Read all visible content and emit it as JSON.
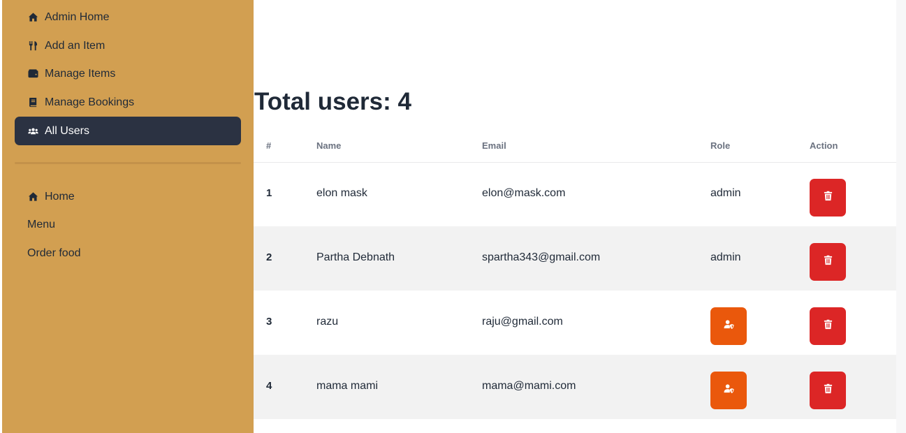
{
  "sidebar": {
    "admin_items": [
      {
        "label": "Admin Home",
        "icon": "home-icon"
      },
      {
        "label": "Add an Item",
        "icon": "utensils-icon"
      },
      {
        "label": "Manage Items",
        "icon": "wallet-icon"
      },
      {
        "label": "Manage Bookings",
        "icon": "book-icon"
      },
      {
        "label": "All Users",
        "icon": "users-icon",
        "active": true
      }
    ],
    "public_items": [
      {
        "label": "Home",
        "icon": "home-icon"
      },
      {
        "label": "Menu"
      },
      {
        "label": "Order food"
      }
    ]
  },
  "main": {
    "title": "Total users: 4",
    "table": {
      "headers": [
        "#",
        "Name",
        "Email",
        "Role",
        "Action"
      ],
      "rows": [
        {
          "num": "1",
          "name": "elon mask",
          "email": "elon@mask.com",
          "role": "admin"
        },
        {
          "num": "2",
          "name": "Partha Debnath",
          "email": "spartha343@gmail.com",
          "role": "admin"
        },
        {
          "num": "3",
          "name": "razu",
          "email": "raju@gmail.com",
          "role": null
        },
        {
          "num": "4",
          "name": "mama mami",
          "email": "mama@mami.com",
          "role": null
        }
      ]
    }
  },
  "colors": {
    "sidebar_bg": "#d29f51",
    "active_item_bg": "#2b3242",
    "delete_button": "#dc2626",
    "make_admin_button": "#ea580c",
    "alt_row": "#f2f2f2"
  }
}
